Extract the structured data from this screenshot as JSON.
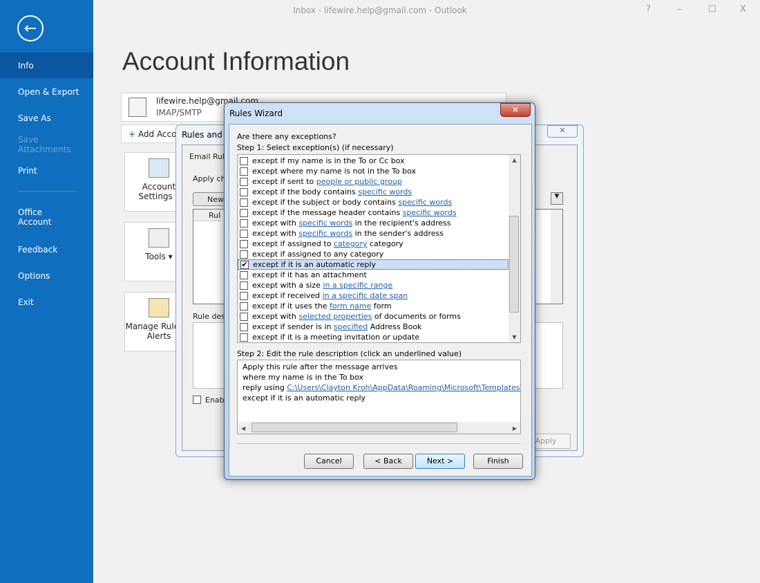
{
  "window": {
    "title": "Inbox - lifewire.help@gmail.com  -  Outlook",
    "help": "?",
    "minimize": "–",
    "maximize": "☐",
    "close": "X"
  },
  "sidebar": {
    "items": [
      {
        "label": "Info",
        "active": true
      },
      {
        "label": "Open & Export"
      },
      {
        "label": "Save As"
      },
      {
        "label": "Save Attachments",
        "disabled": true
      },
      {
        "label": "Print"
      }
    ],
    "items2": [
      {
        "label": "Office\nAccount"
      },
      {
        "label": "Feedback"
      },
      {
        "label": "Options"
      },
      {
        "label": "Exit"
      }
    ]
  },
  "main": {
    "title": "Account Information",
    "account_email": "lifewire.help@gmail.com",
    "account_type": "IMAP/SMTP",
    "add_account": "Add Account",
    "tiles": [
      {
        "label": "Account Settings ▾",
        "icon": "account-settings-icon"
      },
      {
        "label": "Tools ▾",
        "icon": "tools-icon"
      },
      {
        "label": "Manage Rules & Alerts",
        "icon": "manage-rules-icon"
      }
    ]
  },
  "rules_alerts": {
    "title": "Rules and Alerts",
    "tab": "Email Rules",
    "apply": "Apply changes to this folder:",
    "new_rule": "New Rule...",
    "col_rule": "Rule (applied in the order shown)",
    "desc": "Rule description (click an underlined value to edit):",
    "enable": "Enable rules on all messages downloaded from RSS Feeds",
    "apply_btn": "Apply"
  },
  "wizard": {
    "title": "Rules Wizard",
    "question": "Are there any exceptions?",
    "step1": "Step 1: Select exception(s) (if necessary)",
    "exceptions": [
      {
        "pre": "except if my name is in the To or Cc box"
      },
      {
        "pre": "except where my name is not in the To box"
      },
      {
        "pre": "except if sent to ",
        "link": "people or public group"
      },
      {
        "pre": "except if the body contains ",
        "link": "specific words"
      },
      {
        "pre": "except if the subject or body contains ",
        "link": "specific words"
      },
      {
        "pre": "except if the message header contains ",
        "link": "specific words"
      },
      {
        "pre": "except with ",
        "link": "specific words",
        "post": " in the recipient's address"
      },
      {
        "pre": "except with ",
        "link": "specific words",
        "post": " in the sender's address"
      },
      {
        "pre": "except if assigned to ",
        "link": "category",
        "post": " category"
      },
      {
        "pre": "except if assigned to any category"
      },
      {
        "pre": "except if it is an automatic reply",
        "checked": true
      },
      {
        "pre": "except if it has an attachment"
      },
      {
        "pre": "except with a size ",
        "link": "in a specific range"
      },
      {
        "pre": "except if received ",
        "link": "in a specific date span"
      },
      {
        "pre": "except if it uses the ",
        "link": "form name",
        "post": " form"
      },
      {
        "pre": "except with ",
        "link": "selected properties",
        "post": " of documents or forms"
      },
      {
        "pre": "except if sender is in ",
        "link": "specified",
        "post": " Address Book"
      },
      {
        "pre": "except if it is a meeting invitation or update"
      }
    ],
    "step2": "Step 2: Edit the rule description (click an underlined value)",
    "desc_lines": [
      "Apply this rule after the message arrives",
      "where my name is in the To box"
    ],
    "desc_reply_pre": "reply using ",
    "desc_reply_link": "C:\\Users\\Clayton Kroh\\AppData\\Roaming\\Microsoft\\Templates\\Out",
    "desc_last": "except if it is an automatic reply",
    "buttons": {
      "cancel": "Cancel",
      "back": "< Back",
      "next": "Next >",
      "finish": "Finish"
    }
  }
}
